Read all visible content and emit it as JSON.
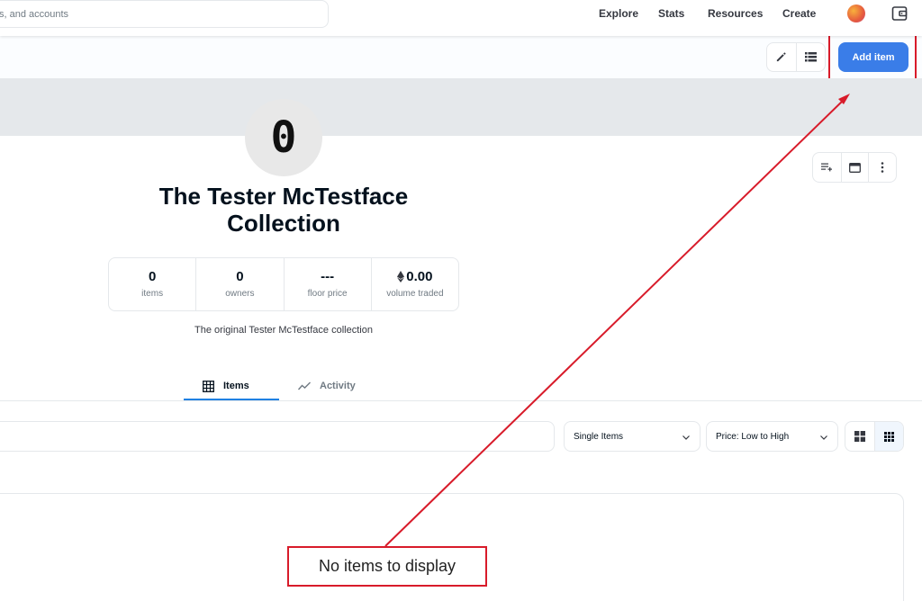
{
  "topnav": {
    "search_placeholder": "s, and accounts",
    "links": [
      "Explore",
      "Stats",
      "Resources",
      "Create"
    ]
  },
  "toolbar": {
    "add_item_label": "Add item"
  },
  "collection": {
    "logo_glyph": "0",
    "title": "The Tester McTestface Collection",
    "description": "The original Tester McTestface collection",
    "stats": [
      {
        "value": "0",
        "label": "items"
      },
      {
        "value": "0",
        "label": "owners"
      },
      {
        "value": "---",
        "label": "floor price"
      },
      {
        "value": "0.00",
        "label": "volume traded"
      }
    ]
  },
  "tabs": [
    {
      "label": "Items",
      "icon": "grid-icon",
      "active": true
    },
    {
      "label": "Activity",
      "icon": "activity-icon",
      "active": false
    }
  ],
  "filters": {
    "sale_type": "Single Items",
    "sort": "Price: Low to High"
  },
  "content": {
    "empty_message": "No items to display"
  },
  "colors": {
    "primary": "#3a7de8",
    "annotation": "#d81b2a",
    "tab_underline": "#2081e2"
  }
}
